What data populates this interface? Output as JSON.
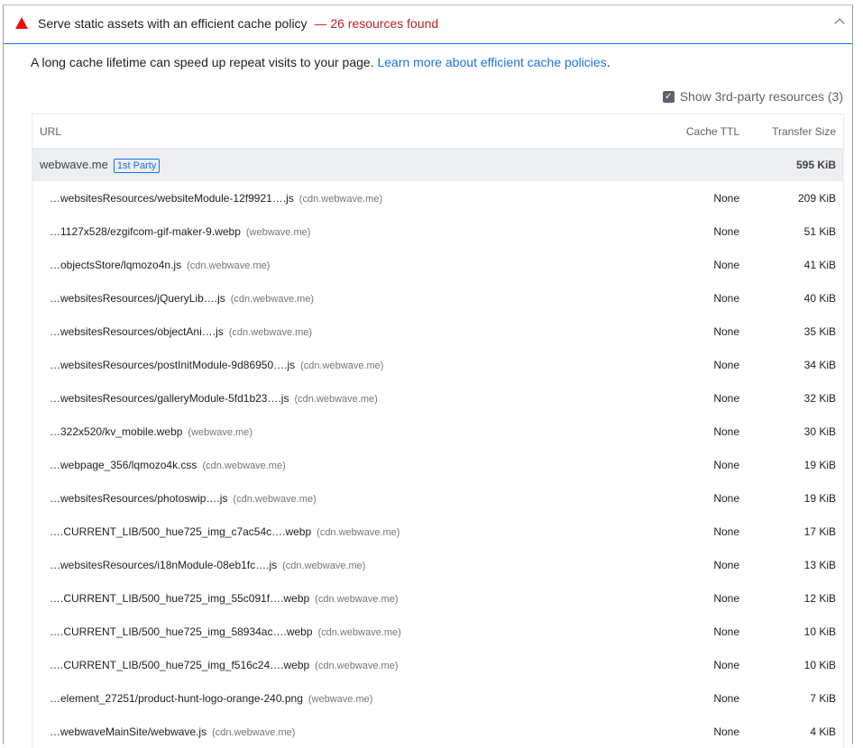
{
  "audit": {
    "title": "Serve static assets with an efficient cache policy",
    "count": "— 26 resources found",
    "description": "A long cache lifetime can speed up repeat visits to your page.",
    "link_text": "Learn more about efficient cache policies",
    "link_suffix": ".",
    "show_3p_label": "Show 3rd-party resources (3)",
    "show_3p_checked": true
  },
  "table": {
    "headers": {
      "url": "URL",
      "ttl": "Cache TTL",
      "size": "Transfer Size"
    },
    "group": {
      "name": "webwave.me",
      "badge": "1st Party",
      "size": "595 KiB"
    },
    "rows": [
      {
        "url": "…websitesResources/websiteModule-12f9921….js",
        "host": "(cdn.webwave.me)",
        "ttl": "None",
        "size": "209 KiB"
      },
      {
        "url": "…1127x528/ezgifcom-gif-maker-9.webp",
        "host": "(webwave.me)",
        "ttl": "None",
        "size": "51 KiB"
      },
      {
        "url": "…objectsStore/lqmozo4n.js",
        "host": "(cdn.webwave.me)",
        "ttl": "None",
        "size": "41 KiB"
      },
      {
        "url": "…websitesResources/jQueryLib….js",
        "host": "(cdn.webwave.me)",
        "ttl": "None",
        "size": "40 KiB"
      },
      {
        "url": "…websitesResources/objectAni….js",
        "host": "(cdn.webwave.me)",
        "ttl": "None",
        "size": "35 KiB"
      },
      {
        "url": "…websitesResources/postInitModule-9d86950….js",
        "host": "(cdn.webwave.me)",
        "ttl": "None",
        "size": "34 KiB"
      },
      {
        "url": "…websitesResources/galleryModule-5fd1b23….js",
        "host": "(cdn.webwave.me)",
        "ttl": "None",
        "size": "32 KiB"
      },
      {
        "url": "…322x520/kv_mobile.webp",
        "host": "(webwave.me)",
        "ttl": "None",
        "size": "30 KiB"
      },
      {
        "url": "…webpage_356/lqmozo4k.css",
        "host": "(cdn.webwave.me)",
        "ttl": "None",
        "size": "19 KiB"
      },
      {
        "url": "…websitesResources/photoswip….js",
        "host": "(cdn.webwave.me)",
        "ttl": "None",
        "size": "19 KiB"
      },
      {
        "url": "….CURRENT_LIB/500_hue725_img_c7ac54c….webp",
        "host": "(cdn.webwave.me)",
        "ttl": "None",
        "size": "17 KiB"
      },
      {
        "url": "…websitesResources/i18nModule-08eb1fc….js",
        "host": "(cdn.webwave.me)",
        "ttl": "None",
        "size": "13 KiB"
      },
      {
        "url": "….CURRENT_LIB/500_hue725_img_55c091f….webp",
        "host": "(cdn.webwave.me)",
        "ttl": "None",
        "size": "12 KiB"
      },
      {
        "url": "….CURRENT_LIB/500_hue725_img_58934ac….webp",
        "host": "(cdn.webwave.me)",
        "ttl": "None",
        "size": "10 KiB"
      },
      {
        "url": "….CURRENT_LIB/500_hue725_img_f516c24….webp",
        "host": "(cdn.webwave.me)",
        "ttl": "None",
        "size": "10 KiB"
      },
      {
        "url": "…element_27251/product-hunt-logo-orange-240.png",
        "host": "(webwave.me)",
        "ttl": "None",
        "size": "7 KiB"
      },
      {
        "url": "…webwaveMainSite/webwave.js",
        "host": "(cdn.webwave.me)",
        "ttl": "None",
        "size": "4 KiB"
      }
    ]
  },
  "colors": {
    "warning": "#eb0f00",
    "count": "#c5221f",
    "link": "#1a73e8",
    "group_bg": "#eceef1"
  },
  "icons": {
    "warning": "warning-triangle-icon",
    "collapse": "chevron-up-icon",
    "checkbox": "checkbox-checked-icon"
  }
}
